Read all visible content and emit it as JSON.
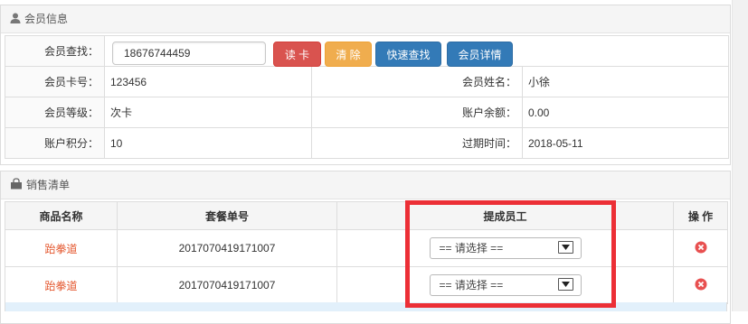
{
  "member_panel": {
    "title": "会员信息",
    "search_label": "会员查找：",
    "search_value": "18676744459",
    "buttons": {
      "read_card": "读 卡",
      "clear": "清 除",
      "quick_search": "快速查找",
      "member_detail": "会员详情"
    },
    "card_no_label": "会员卡号：",
    "card_no": "123456",
    "name_label": "会员姓名：",
    "name": "小徐",
    "level_label": "会员等级：",
    "level": "次卡",
    "balance_label": "账户余额：",
    "balance": "0.00",
    "points_label": "账户积分：",
    "points": "10",
    "expire_label": "过期时间：",
    "expire": "2018-05-11"
  },
  "sales_panel": {
    "title": "销售清单",
    "columns": {
      "product": "商品名称",
      "package_no": "套餐单号",
      "staff": "提成员工",
      "action": "操 作"
    },
    "rows": [
      {
        "product": "跆拳道",
        "package_no": "2017070419171007",
        "staff": "== 请选择 =="
      },
      {
        "product": "跆拳道",
        "package_no": "2017070419171007",
        "staff": "== 请选择 =="
      }
    ]
  },
  "colors": {
    "danger": "#d9534f",
    "warning": "#f0ad4e",
    "primary": "#337ab7",
    "highlight": "#ec2f36",
    "product_link": "#e4572e"
  },
  "icons": {
    "member_panel": "user-icon",
    "sales_panel": "shopping-bag-icon",
    "row_action": "delete-circle-icon",
    "select_toggle": "chevron-down-icon"
  }
}
